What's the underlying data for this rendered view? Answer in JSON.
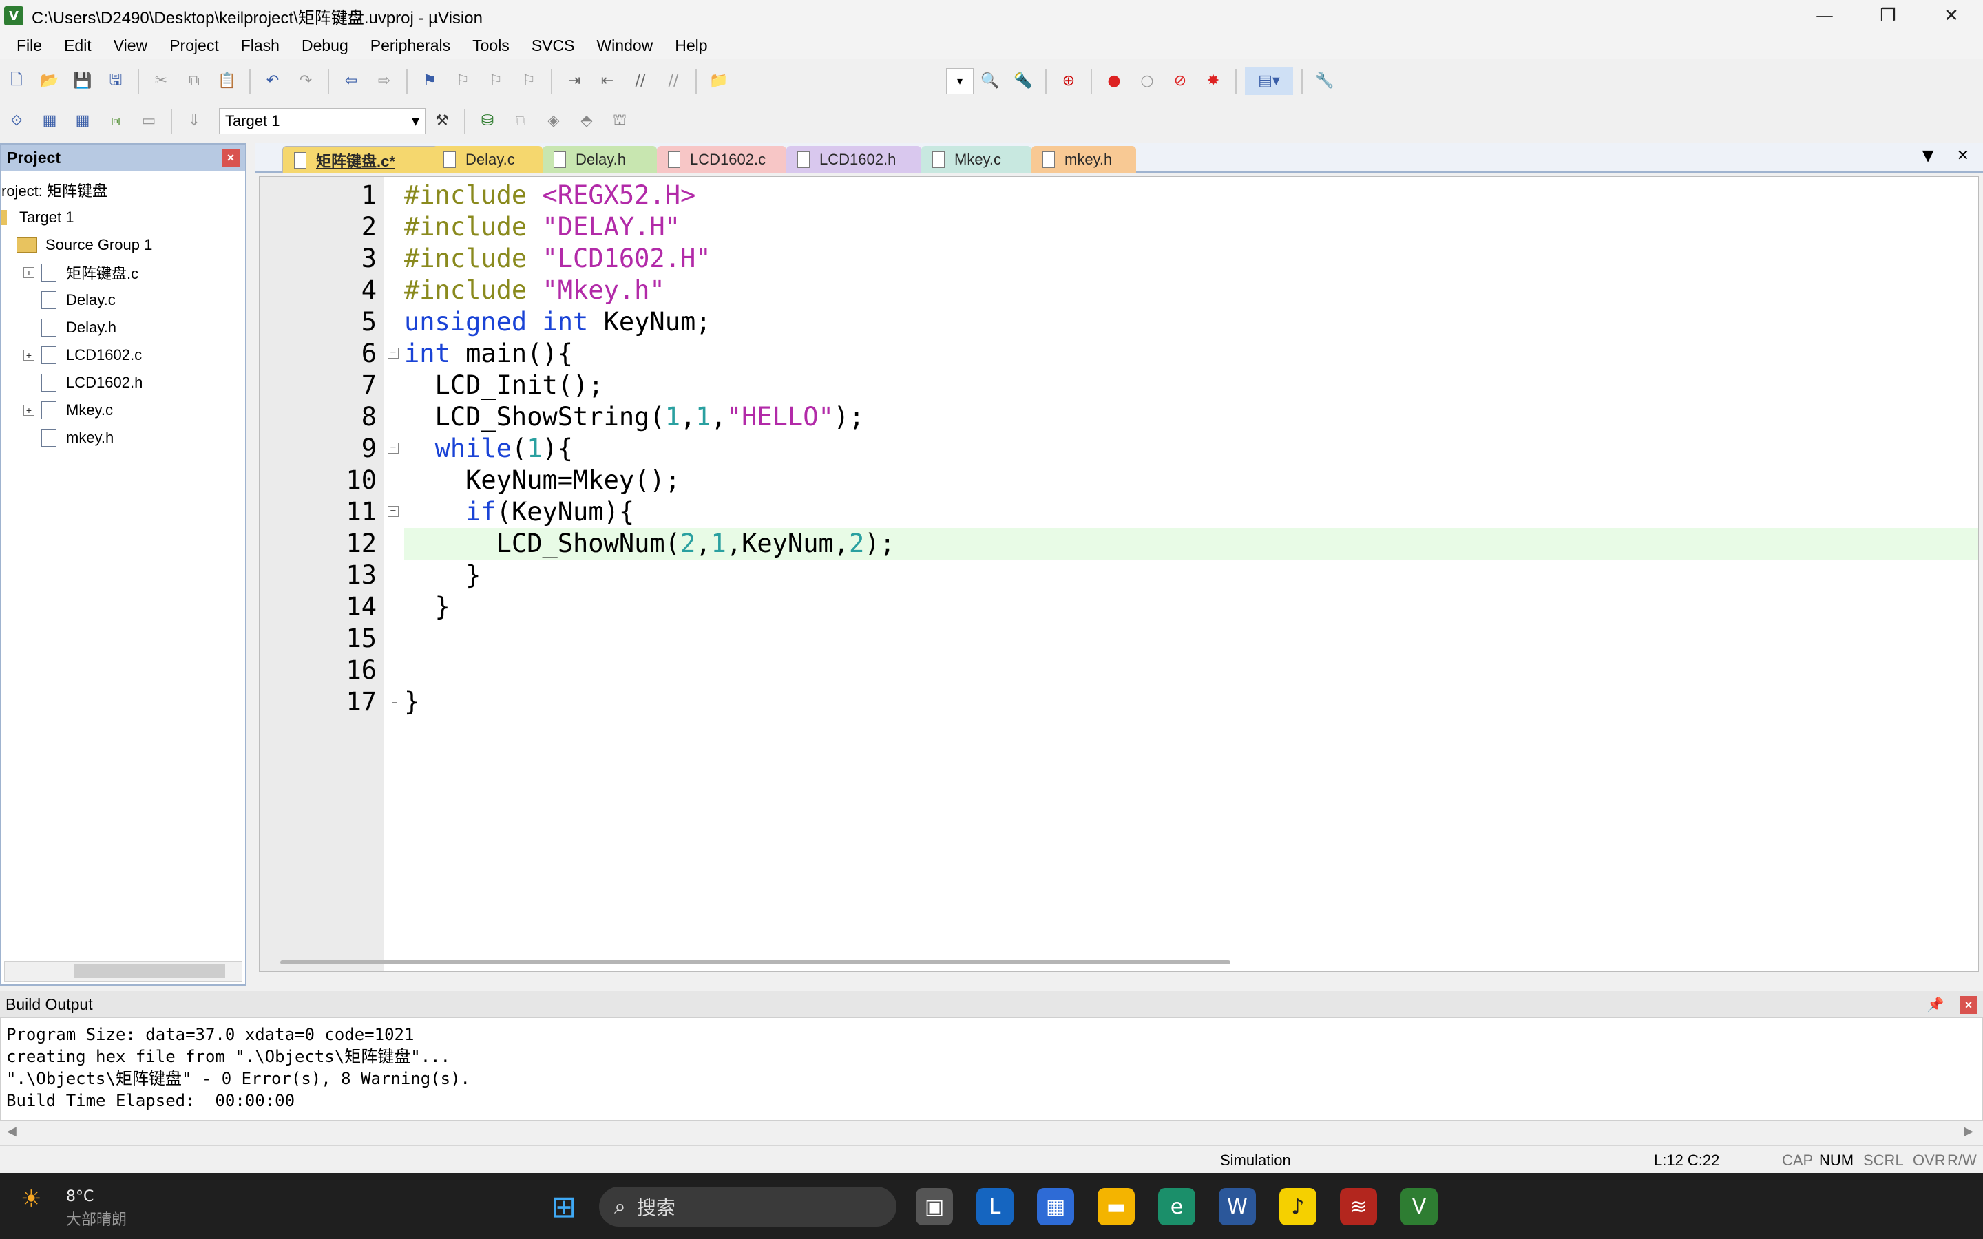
{
  "window": {
    "title": "C:\\Users\\D2490\\Desktop\\keilproject\\矩阵键盘.uvproj - µVision",
    "app_icon": "V",
    "minimize": "—",
    "restore": "❐",
    "close": "✕"
  },
  "menu": [
    "File",
    "Edit",
    "View",
    "Project",
    "Flash",
    "Debug",
    "Peripherals",
    "Tools",
    "SVCS",
    "Window",
    "Help"
  ],
  "toolbar2": {
    "target": "Target 1"
  },
  "project_panel": {
    "title": "Project",
    "root": "roject: 矩阵键盘",
    "target": "Target 1",
    "group": "Source Group 1",
    "files": [
      {
        "name": "矩阵键盘.c",
        "expandable": true
      },
      {
        "name": "Delay.c",
        "expandable": false
      },
      {
        "name": "Delay.h",
        "expandable": false
      },
      {
        "name": "LCD1602.c",
        "expandable": true
      },
      {
        "name": "LCD1602.h",
        "expandable": false
      },
      {
        "name": "Mkey.c",
        "expandable": true
      },
      {
        "name": "mkey.h",
        "expandable": false
      }
    ]
  },
  "tabs": [
    {
      "label": "矩阵键盘.c*",
      "color": "#f5d76e",
      "active": true
    },
    {
      "label": "Delay.c",
      "color": "#f5d76e"
    },
    {
      "label": "Delay.h",
      "color": "#c8e6b0"
    },
    {
      "label": "LCD1602.c",
      "color": "#f7c6c6"
    },
    {
      "label": "LCD1602.h",
      "color": "#d9c8ee"
    },
    {
      "label": "Mkey.c",
      "color": "#c8e8e0"
    },
    {
      "label": "mkey.h",
      "color": "#f8c994"
    }
  ],
  "code": {
    "current_line": 12,
    "lines": [
      "1",
      "2",
      "3",
      "4",
      "5",
      "6",
      "7",
      "8",
      "9",
      "10",
      "11",
      "12",
      "13",
      "14",
      "15",
      "16",
      "17"
    ]
  },
  "build_output": {
    "title": "Build Output",
    "lines": [
      "Program Size: data=37.0 xdata=0 code=1021",
      "creating hex file from \".\\Objects\\矩阵键盘\"...",
      "\".\\Objects\\矩阵键盘\" - 0 Error(s), 8 Warning(s).",
      "Build Time Elapsed:  00:00:00"
    ]
  },
  "status": {
    "mode": "Simulation",
    "position": "L:12 C:22",
    "caps": "CAP",
    "num": "NUM",
    "scrl": "SCRL",
    "ovr": "OVR",
    "rw": "R/W"
  },
  "taskbar": {
    "weather_temp": "8°C",
    "weather_desc": "大部晴朗",
    "search_placeholder": "搜索"
  },
  "colors": {
    "keyword": "#1a43d6",
    "preprocessor": "#8a8a1e",
    "string": "#b22aa8",
    "number": "#2aa0a0",
    "current_line_bg": "#e8fbe6"
  }
}
